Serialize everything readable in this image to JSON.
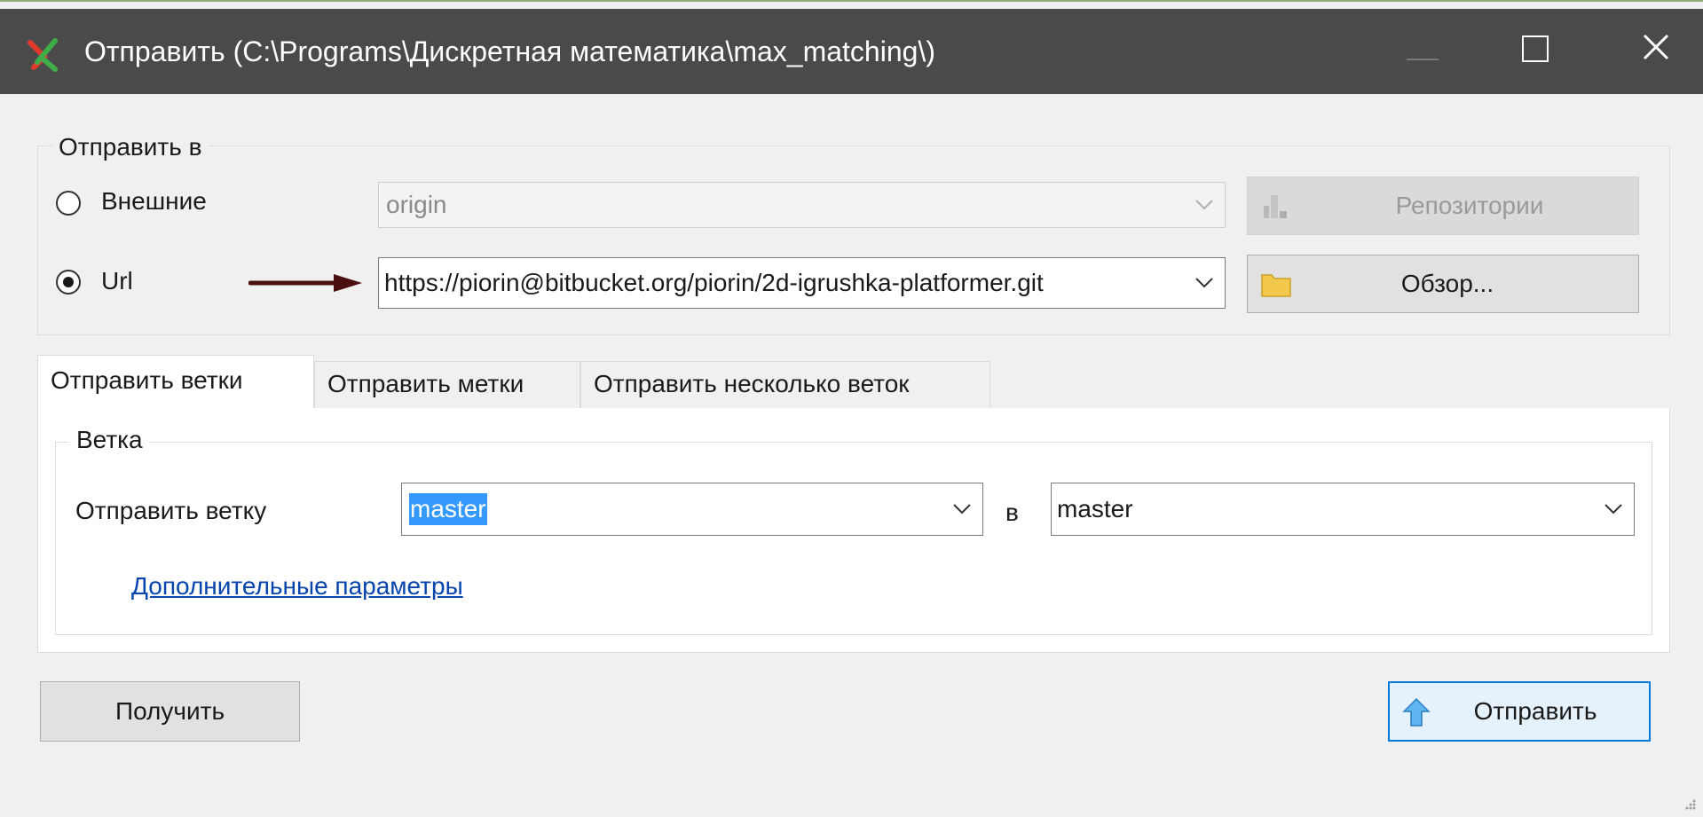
{
  "window": {
    "title": "Отправить (C:\\Programs\\Дискретная математика\\max_matching\\)",
    "accent_color": "#0078d7"
  },
  "push_to": {
    "legend": "Отправить в",
    "remote_option_label": "Внешние",
    "remote_value": "origin",
    "url_option_label": "Url",
    "url_value": "https://piorin@bitbucket.org/piorin/2d-igrushka-platformer.git",
    "selected_option": "Url",
    "repositories_button": "Репозитории",
    "browse_button": "Обзор..."
  },
  "tabs": [
    {
      "label": "Отправить ветки",
      "active": true
    },
    {
      "label": "Отправить метки",
      "active": false
    },
    {
      "label": "Отправить несколько веток",
      "active": false
    }
  ],
  "branch_group": {
    "legend": "Ветка",
    "push_branch_label": "Отправить ветку",
    "local_branch": "master",
    "to_label": "в",
    "remote_branch": "master",
    "advanced_link": "Дополнительные параметры"
  },
  "footer": {
    "pull_button": "Получить",
    "push_button": "Отправить"
  }
}
